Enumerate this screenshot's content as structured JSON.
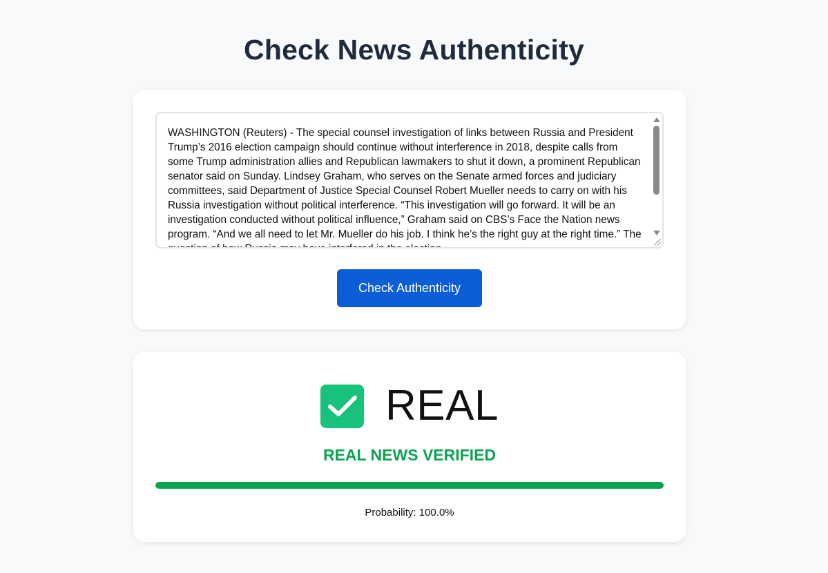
{
  "page": {
    "title": "Check News Authenticity"
  },
  "input": {
    "text": "WASHINGTON (Reuters) - The special counsel investigation of links between Russia and President Trump’s 2016 election campaign should continue without interference in 2018, despite calls from some Trump administration allies and Republican lawmakers to shut it down, a prominent Republican senator said on Sunday. Lindsey Graham, who serves on the Senate armed forces and judiciary committees, said Department of Justice Special Counsel Robert Mueller needs to carry on with his Russia investigation without political interference. “This investigation will go forward. It will be an investigation conducted without political influence,” Graham said on CBS’s Face the Nation news program. “And we all need to let Mr. Mueller do his job. I think he’s the right guy at the right time.” The question of how Russia may have interfered in the election",
    "button_label": "Check Authenticity"
  },
  "result": {
    "label": "REAL",
    "subtitle": "REAL NEWS VERIFIED",
    "probability_text": "Probability: 100.0%",
    "probability_value": 1.0,
    "icon": "check-icon",
    "colors": {
      "icon_bg": "#19c27a",
      "verdict": "#0aa34f",
      "bar": "#0aa34f",
      "button": "#0b5ed7"
    }
  }
}
